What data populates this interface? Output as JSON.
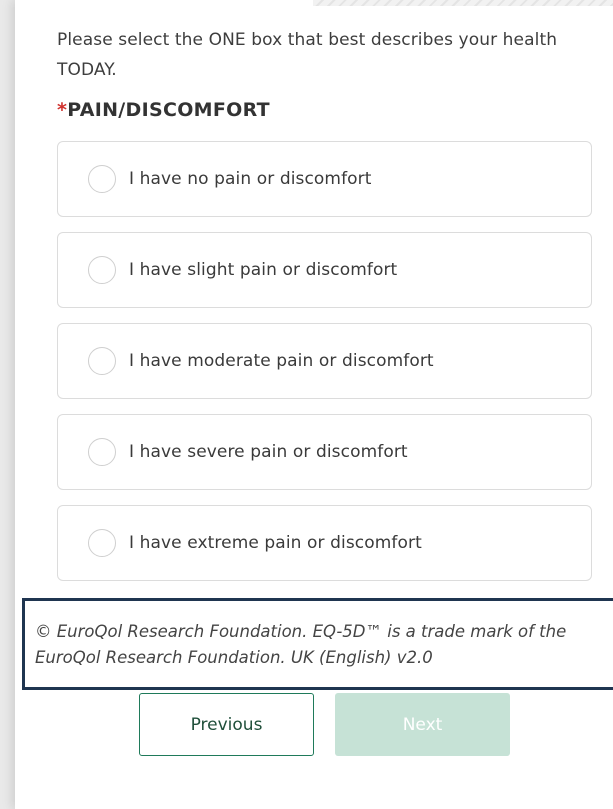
{
  "instruction": "Please select the ONE box that best describes your health TODAY.",
  "question": {
    "required_marker": "*",
    "title": "PAIN/DISCOMFORT"
  },
  "options": [
    {
      "label": "I have no pain or discomfort",
      "selected": false
    },
    {
      "label": "I have slight pain or discomfort",
      "selected": false
    },
    {
      "label": "I have moderate pain or discomfort",
      "selected": false
    },
    {
      "label": "I have severe pain or discomfort",
      "selected": false
    },
    {
      "label": "I have extreme pain or discomfort",
      "selected": false
    }
  ],
  "copyright": "© EuroQol Research Foundation. EQ-5D™ is a trade mark of the EuroQol Research Foundation. UK (English) v2.0",
  "buttons": {
    "previous": "Previous",
    "next": "Next",
    "next_disabled": true
  },
  "colors": {
    "required": "#d0312d",
    "primary": "#1f7a5a",
    "next_disabled_bg": "#c6e2d6",
    "highlight_border": "#1f3550"
  }
}
